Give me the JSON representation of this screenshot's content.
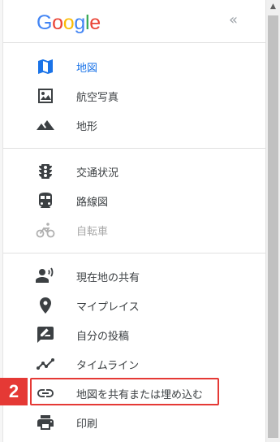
{
  "header": {
    "logo": {
      "g1": "G",
      "o1": "o",
      "o2": "o",
      "g2": "g",
      "l": "l",
      "e": "e"
    },
    "collapse_label": "«"
  },
  "menu": {
    "map_types": [
      {
        "label": "地図",
        "icon": "map-icon",
        "state": "active"
      },
      {
        "label": "航空写真",
        "icon": "satellite-icon",
        "state": "normal"
      },
      {
        "label": "地形",
        "icon": "terrain-icon",
        "state": "normal"
      }
    ],
    "layers": [
      {
        "label": "交通状況",
        "icon": "traffic-icon",
        "state": "normal"
      },
      {
        "label": "路線図",
        "icon": "transit-icon",
        "state": "normal"
      },
      {
        "label": "自転車",
        "icon": "bicycle-icon",
        "state": "disabled"
      }
    ],
    "actions": [
      {
        "label": "現在地の共有",
        "icon": "location-sharing-icon"
      },
      {
        "label": "マイプレイス",
        "icon": "place-pin-icon"
      },
      {
        "label": "自分の投稿",
        "icon": "contributions-icon"
      },
      {
        "label": "タイムライン",
        "icon": "timeline-icon"
      },
      {
        "label": "地図を共有または埋め込む",
        "icon": "link-icon"
      },
      {
        "label": "印刷",
        "icon": "print-icon"
      }
    ]
  },
  "annotation": {
    "step_number": "2"
  },
  "scrollbar": {
    "up_arrow": "▲"
  },
  "colors": {
    "accent": "#1a73e8",
    "icon": "#3c4043",
    "disabled": "#a8a8a8",
    "highlight": "#e53935"
  }
}
